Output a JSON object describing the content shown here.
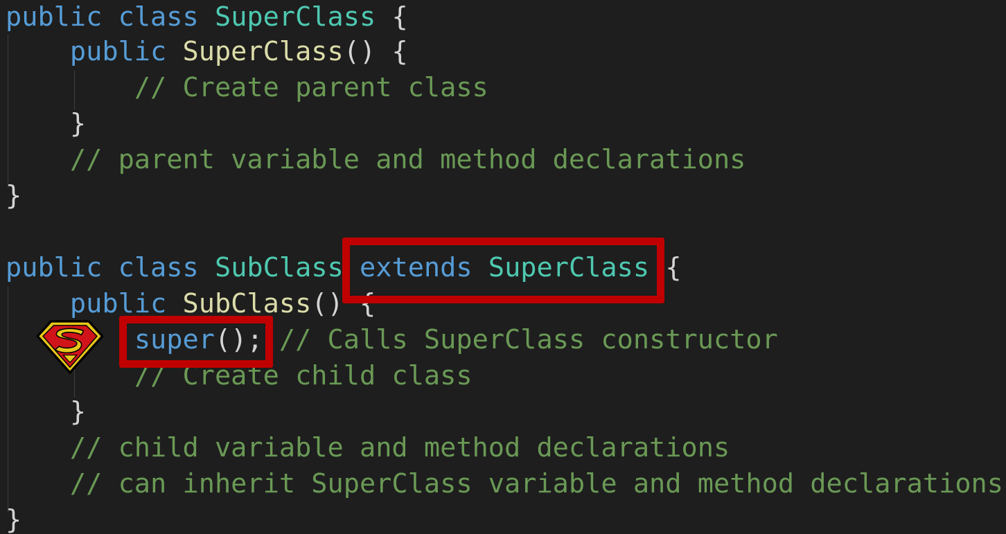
{
  "code": {
    "line1": {
      "kw1": "public",
      "kw2": "class",
      "name": "SuperClass",
      "brace": "{"
    },
    "line2": {
      "kw": "public",
      "name": "SuperClass",
      "rest": "() {"
    },
    "line3": {
      "comment": "// Create parent class"
    },
    "line4": {
      "brace": "}"
    },
    "line5": {
      "comment": "// parent variable and method declarations"
    },
    "line6": {
      "brace": "}"
    },
    "line7": {
      "kw1": "public",
      "kw2": "class",
      "name": "SubClass",
      "extends_kw": "extends",
      "parent": "SuperClass",
      "brace": "{"
    },
    "line8": {
      "kw": "public",
      "name": "SubClass",
      "rest": "() {"
    },
    "line9": {
      "call": "super",
      "rest": "();",
      "comment": "// Calls SuperClass constructor"
    },
    "line10": {
      "comment": "// Create child class"
    },
    "line11": {
      "brace": "}"
    },
    "line12": {
      "comment": "// child variable and method declarations"
    },
    "line13": {
      "comment": "// can inherit SuperClass variable and method declarations"
    },
    "line14": {
      "brace": "}"
    }
  },
  "annotations": {
    "highlight_color": "#c00000",
    "icon": "superman-shield-icon"
  },
  "colors": {
    "background": "#1e1e1e",
    "keyword": "#569cd6",
    "class_name": "#4ec9b0",
    "function": "#dcdcaa",
    "comment": "#6a9955",
    "punctuation": "#d4d4d4"
  }
}
